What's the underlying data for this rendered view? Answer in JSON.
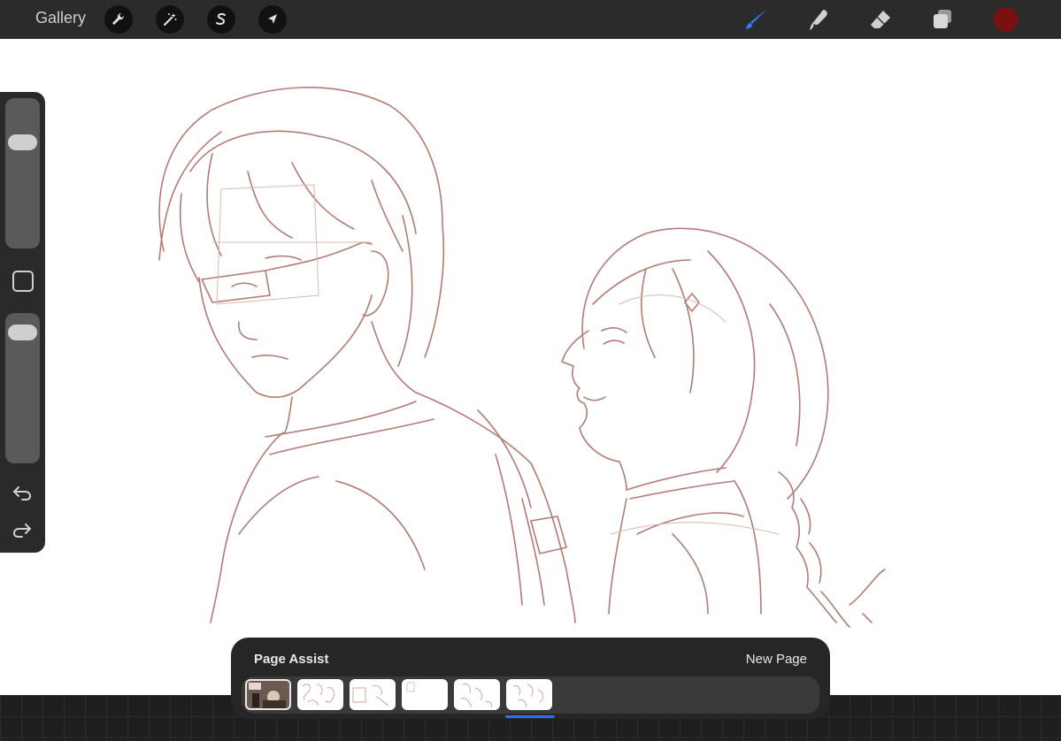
{
  "topbar": {
    "gallery_label": "Gallery",
    "left_tools": [
      "wrench-icon",
      "magic-wand-icon",
      "selection-s-icon",
      "transform-arrow-icon"
    ],
    "right_tools": [
      "brush-icon",
      "smudge-icon",
      "eraser-icon",
      "layers-icon"
    ],
    "active_tool": "brush-icon",
    "accent_color": "#2f7bff",
    "current_color": "#7a1010"
  },
  "sidebar": {
    "brush_size_level": 0.26,
    "opacity_level": 0.06,
    "icons": [
      "modify-square-icon",
      "undo-icon",
      "redo-icon"
    ]
  },
  "page_assist": {
    "title": "Page Assist",
    "new_page_label": "New Page",
    "page_count": 6,
    "active_page": 1
  },
  "sketch": {
    "stroke_color": "#b37b72"
  }
}
